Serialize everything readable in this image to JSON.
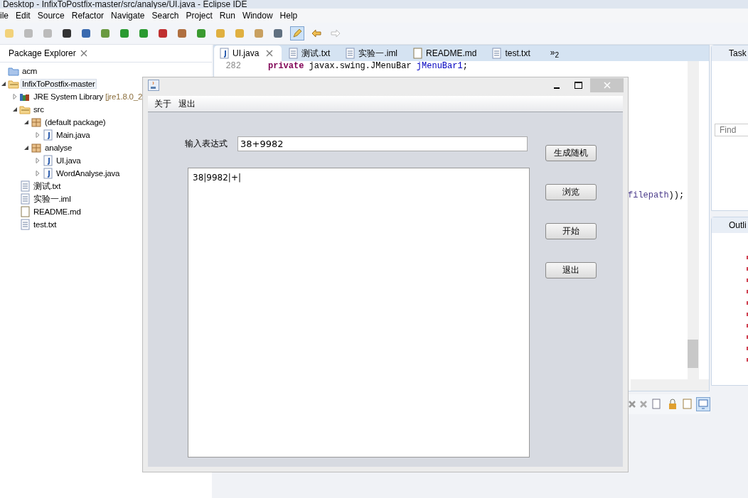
{
  "ide": {
    "title": "Desktop - InfixToPostfix-master/src/analyse/UI.java - Eclipse IDE",
    "menu": [
      "ile",
      "Edit",
      "Source",
      "Refactor",
      "Navigate",
      "Search",
      "Project",
      "Run",
      "Window",
      "Help"
    ],
    "highlight_toggle": {
      "on": true
    },
    "package_explorer": {
      "title": "Package Explorer",
      "tree": [
        {
          "kind": "folder",
          "label": "acm",
          "selected": false
        },
        {
          "kind": "project",
          "label": "InfixToPostfix-master",
          "selected": true,
          "expanded": true,
          "children": [
            {
              "kind": "library",
              "label": "JRE System Library",
              "decoration": "[jre1.8.0_2",
              "selected": false,
              "expanded": false
            },
            {
              "kind": "source",
              "label": "src",
              "selected": false,
              "expanded": true,
              "children": [
                {
                  "kind": "package",
                  "label": "(default package)",
                  "selected": false,
                  "expanded": true,
                  "children": [
                    {
                      "kind": "java",
                      "label": "Main.java",
                      "selected": false,
                      "expanded": false
                    }
                  ]
                },
                {
                  "kind": "package",
                  "label": "analyse",
                  "selected": false,
                  "expanded": true,
                  "children": [
                    {
                      "kind": "java",
                      "label": "UI.java",
                      "selected": false,
                      "expanded": false
                    },
                    {
                      "kind": "java",
                      "label": "WordAnalyse.java",
                      "selected": false,
                      "expanded": false
                    }
                  ]
                }
              ]
            },
            {
              "kind": "text",
              "label": "测试.txt",
              "selected": false
            },
            {
              "kind": "text",
              "label": "实验一.iml",
              "selected": false
            },
            {
              "kind": "word",
              "label": "README.md",
              "selected": false
            },
            {
              "kind": "text",
              "label": "test.txt",
              "selected": false
            }
          ]
        }
      ]
    },
    "editor": {
      "tabs": [
        {
          "kind": "java",
          "label": "UI.java",
          "selected": true
        },
        {
          "kind": "text",
          "label": "测试.txt",
          "selected": false
        },
        {
          "kind": "text",
          "label": "实验一.iml",
          "selected": false
        },
        {
          "kind": "word",
          "label": "README.md",
          "selected": false
        },
        {
          "kind": "text",
          "label": "test.txt",
          "selected": false
        }
      ],
      "overflow": "»",
      "overflow_count": "2",
      "lines": [
        {
          "number": "282",
          "tokens": [
            {
              "kind": "keyword",
              "text": "private"
            },
            {
              "kind": "plain",
              "text": "javax.swing.JMenuBar"
            },
            {
              "kind": "field",
              "text": "jMenuBar1"
            },
            {
              "kind": "plain",
              "text": ";"
            }
          ]
        }
      ],
      "fragment": [
        {
          "kind": "local",
          "text": "filepath"
        },
        {
          "kind": "plain",
          "text": "));"
        }
      ]
    },
    "task_panel": {
      "title": "Task",
      "find_placeholder": "Find"
    },
    "outline": {
      "title": "Outli"
    },
    "console_toggle": {
      "on": true
    }
  },
  "dialog": {
    "menu": [
      "关于",
      "退出"
    ],
    "expression_label": "输入表达式",
    "expression_value": "38+9982",
    "output": "38|9982|+|",
    "buttons": [
      "生成随机",
      "浏览",
      "开始",
      "退出"
    ]
  }
}
